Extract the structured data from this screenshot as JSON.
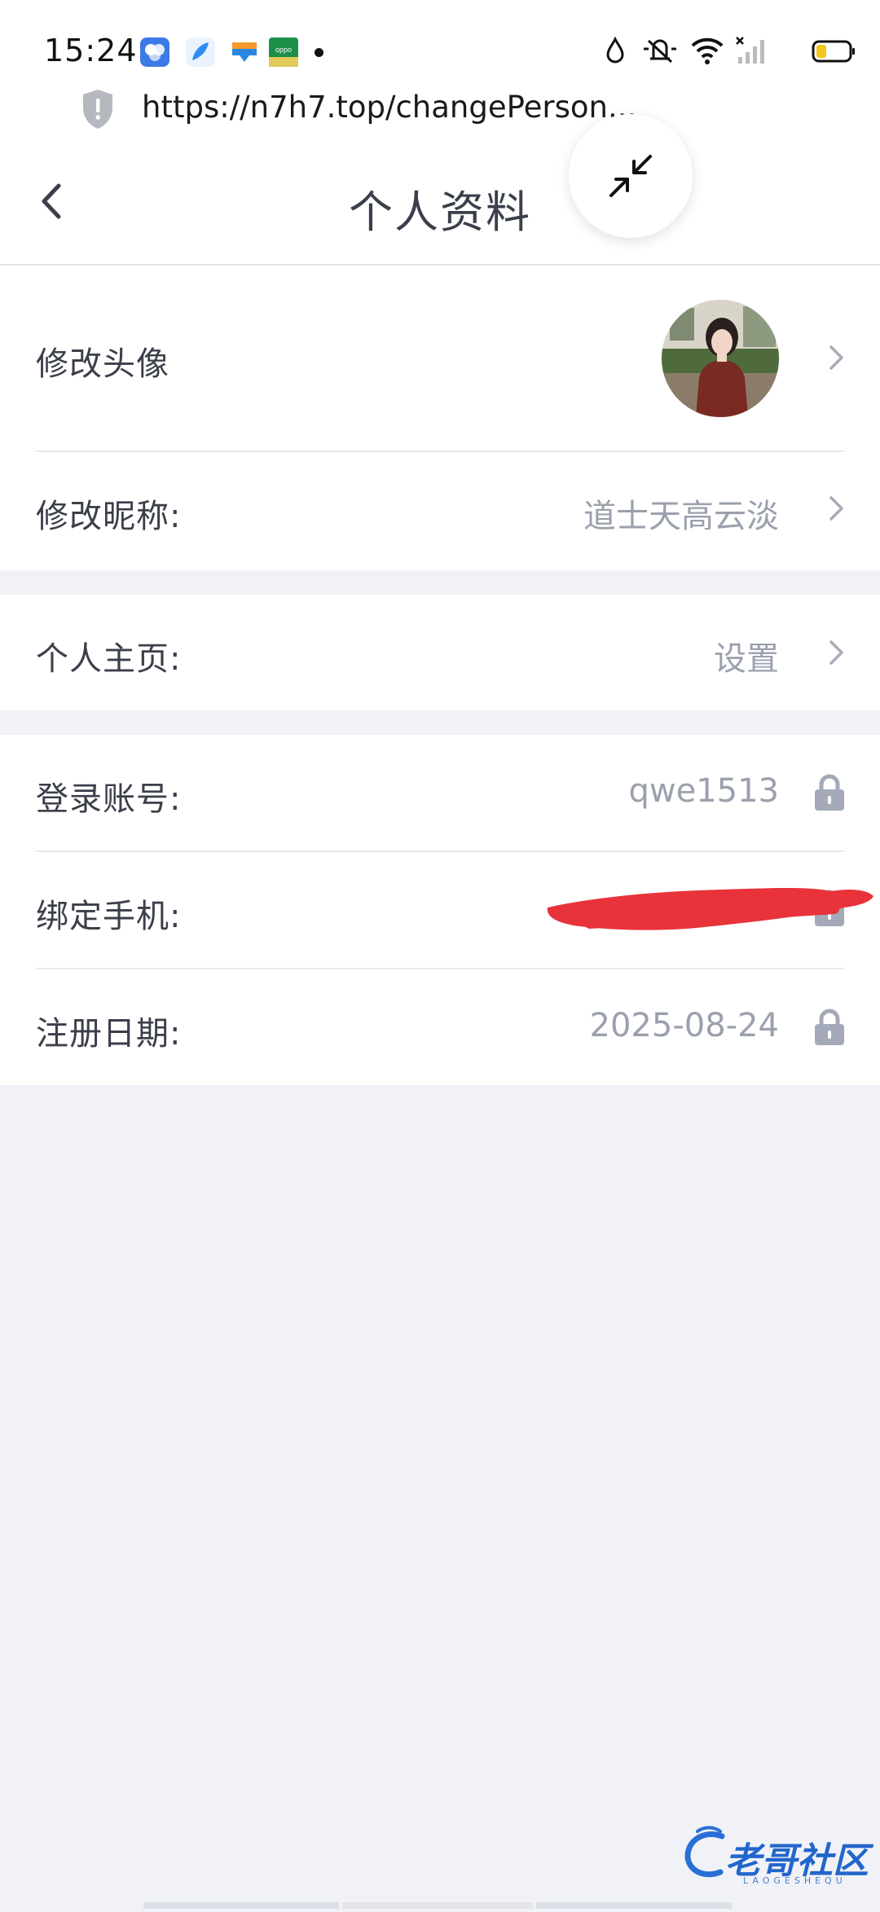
{
  "status_bar": {
    "time": "15:24",
    "app_icons": [
      "grid-app-icon",
      "feather-app-icon",
      "wallet-app-icon",
      "oppo-app-icon"
    ],
    "right_icons": [
      "water-drop-icon",
      "mute-icon",
      "wifi-icon",
      "no-signal-icon",
      "battery-icon"
    ]
  },
  "url_bar": {
    "url": "https://n7h7.top/changePerson..."
  },
  "header": {
    "title": "个人资料"
  },
  "section1": {
    "avatar_label": "修改头像",
    "nickname_label": "修改昵称:",
    "nickname_value": "道士天高云淡"
  },
  "section2": {
    "homepage_label": "个人主页:",
    "homepage_value": "设置"
  },
  "section3": {
    "account_label": "登录账号:",
    "account_value": "qwe1513",
    "phone_label": "绑定手机:",
    "phone_value": "",
    "register_label": "注册日期:",
    "register_value": "2025-08-24"
  },
  "watermark": {
    "text": "老哥社区",
    "subtext": "LAOGESHEQU"
  },
  "colors": {
    "label": "#3b3f4a",
    "value": "#9aa0ad",
    "background": "#f0f2f7",
    "redaction": "#e8333a"
  }
}
